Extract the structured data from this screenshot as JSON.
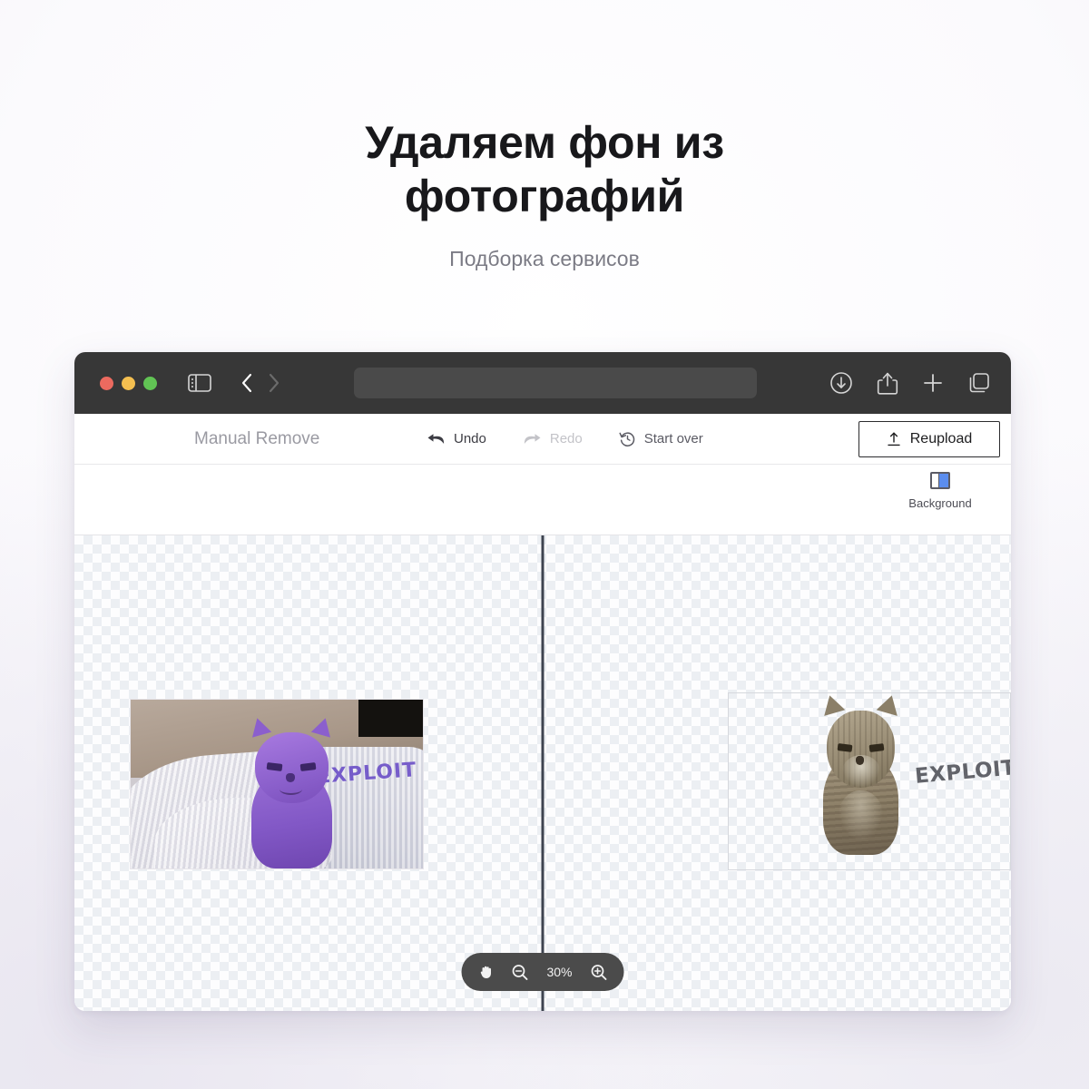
{
  "hero": {
    "title_line1": "Удаляем фон из",
    "title_line2": "фотографий",
    "subtitle": "Подборка сервисов"
  },
  "browser": {
    "traffic_lights": [
      "close",
      "minimize",
      "maximize"
    ],
    "sidebar_toggle_icon": "sidebar-icon",
    "back_icon": "chevron-left-icon",
    "forward_icon": "chevron-right-icon",
    "address_value": "",
    "address_placeholder": "",
    "right_icons": [
      "download-icon",
      "share-icon",
      "new-tab-icon",
      "tab-overview-icon"
    ],
    "colors": {
      "titlebar": "#373737",
      "addressbar": "#4a4a4a"
    }
  },
  "app": {
    "title": "Manual Remove",
    "undo_label": "Undo",
    "redo_label": "Redo",
    "start_over_label": "Start over",
    "reupload_label": "Reupload",
    "background_tool_label": "Background",
    "background_accent": "#5b8def"
  },
  "canvas": {
    "zoom_level": "30%",
    "hand_tool_icon": "hand-icon",
    "zoom_out_icon": "zoom-out-icon",
    "zoom_in_icon": "zoom-in-icon",
    "left_image_text": "EXPLOIT",
    "right_image_text": "EXPLOIT",
    "left_mask_color": "#8258c6"
  }
}
